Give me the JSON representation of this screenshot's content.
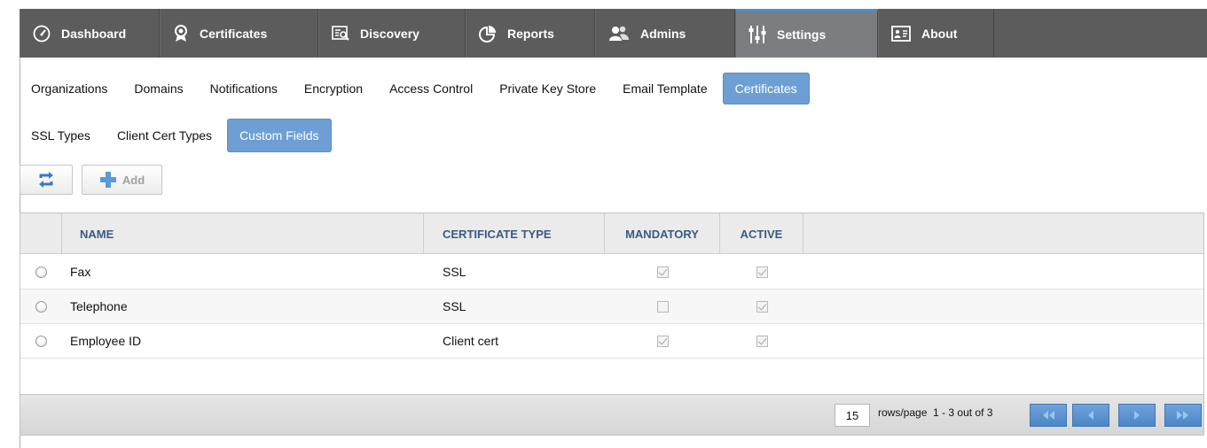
{
  "topnav": {
    "tabs": [
      {
        "label": "Dashboard",
        "icon": "gauge-icon"
      },
      {
        "label": "Certificates",
        "icon": "certificate-badge-icon"
      },
      {
        "label": "Discovery",
        "icon": "discovery-icon"
      },
      {
        "label": "Reports",
        "icon": "pie-chart-icon"
      },
      {
        "label": "Admins",
        "icon": "users-icon"
      },
      {
        "label": "Settings",
        "icon": "sliders-icon"
      },
      {
        "label": "About",
        "icon": "id-card-icon"
      }
    ],
    "active": "Settings"
  },
  "subnav": {
    "items": [
      "Organizations",
      "Domains",
      "Notifications",
      "Encryption",
      "Access Control",
      "Private Key Store",
      "Email Template",
      "Certificates"
    ],
    "active": "Certificates"
  },
  "subnav2": {
    "items": [
      "SSL Types",
      "Client Cert Types",
      "Custom Fields"
    ],
    "active": "Custom Fields"
  },
  "toolbar": {
    "refresh_icon": "refresh-icon",
    "add_label": "Add",
    "add_icon": "plus-icon"
  },
  "grid": {
    "columns": [
      "NAME",
      "CERTIFICATE TYPE",
      "MANDATORY",
      "ACTIVE"
    ],
    "rows": [
      {
        "name": "Fax",
        "type": "SSL",
        "mandatory": true,
        "active": true
      },
      {
        "name": "Telephone",
        "type": "SSL",
        "mandatory": false,
        "active": true
      },
      {
        "name": "Employee ID",
        "type": "Client cert",
        "mandatory": true,
        "active": true
      }
    ]
  },
  "pager": {
    "rows_per_page": "15",
    "rows_label": "rows/page",
    "range": "1 - 3 out of 3",
    "buttons": [
      "first-page-icon",
      "prev-page-icon",
      "next-page-icon",
      "last-page-icon"
    ]
  },
  "colors": {
    "nav_bg": "#5c5c5c",
    "nav_active": "#7b7d80",
    "accent": "#6e9fd4",
    "header_text": "#3b5a82"
  }
}
